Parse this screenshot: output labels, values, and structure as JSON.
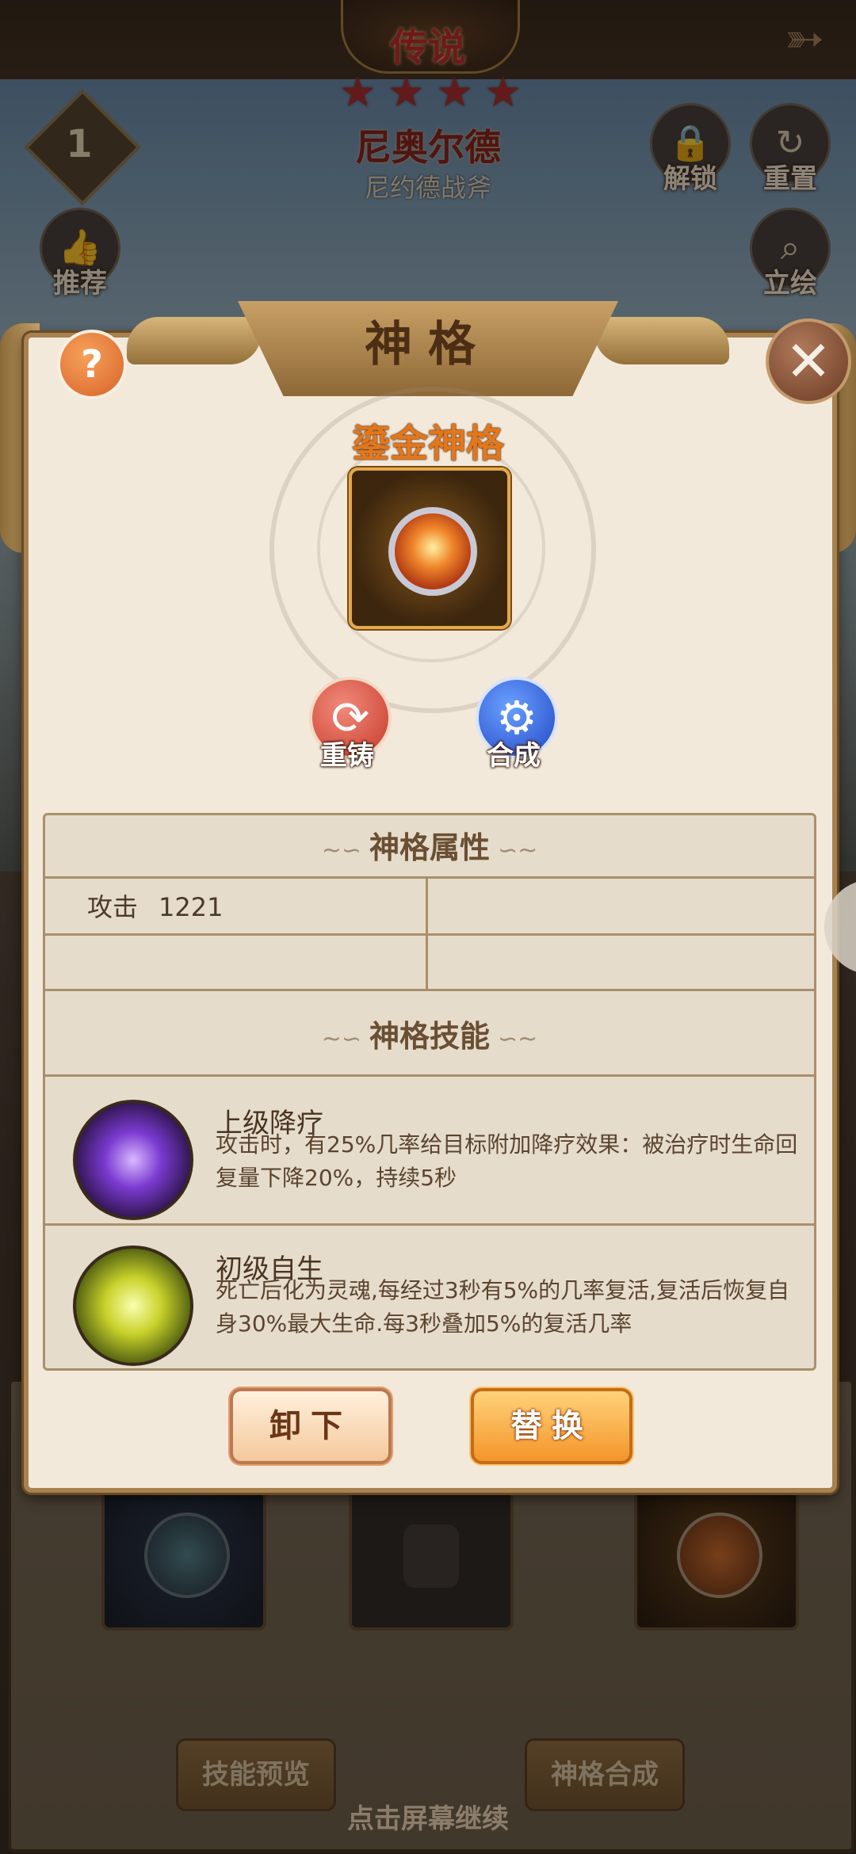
{
  "top": {
    "rarity": "传说",
    "hero_name": "尼奥尔德",
    "weapon_name": "尼约德战斧",
    "level": "1",
    "stars": [
      "★",
      "★",
      "★",
      "★"
    ],
    "back_icon": "bow-arrow-icon"
  },
  "side_buttons": {
    "recommend": "推荐",
    "unlock": "解锁",
    "reset": "重置",
    "portrait": "立绘"
  },
  "dialog": {
    "title": "神格",
    "help": "?",
    "close": "✕",
    "item_name": "鎏金神格",
    "reforge": "重铸",
    "combine": "合成",
    "attr_section": "神格属性",
    "attributes": [
      {
        "label": "攻击",
        "value": "1221"
      }
    ],
    "skill_section": "神格技能",
    "skills": [
      {
        "name": "上级降疗",
        "desc": "攻击时，有25%几率给目标附加降疗效果：被治疗时生命回复量下降20%，持续5秒"
      },
      {
        "name": "初级自生",
        "desc": "死亡后化为灵魂,每经过3秒有5%的几率复活,复活后恢复自身30%最大生命.每3秒叠加5%的复活几率"
      }
    ],
    "unequip": "卸下",
    "replace": "替换"
  },
  "bottom": {
    "skill_preview": "技能预览",
    "divinity_combine": "神格合成",
    "tap_continue": "点击屏幕继续"
  },
  "colors": {
    "accent_orange": "#e3771b",
    "dialog_bg": "#f2e9db",
    "legend_red": "#b8232a"
  }
}
